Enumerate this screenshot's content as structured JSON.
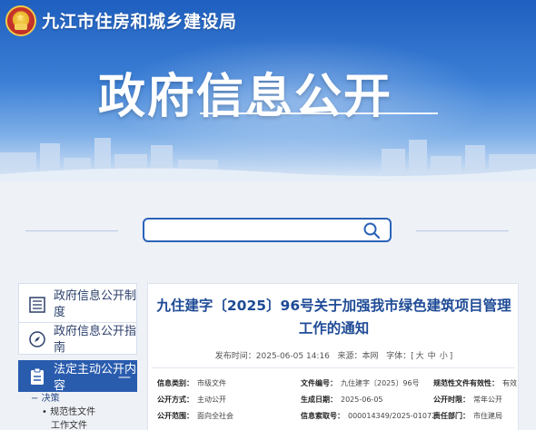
{
  "header": {
    "site_name": "九江市住房和城乡建设局",
    "page_heading": "政府信息公开"
  },
  "search": {
    "placeholder": "",
    "value": ""
  },
  "sidebar": {
    "items": [
      {
        "label": "政府信息公开制度",
        "icon": "document-list-icon"
      },
      {
        "label": "政府信息公开指南",
        "icon": "compass-icon"
      },
      {
        "label": "法定主动公开内容",
        "icon": "clipboard-icon",
        "toggle": "—"
      }
    ],
    "sub_items": [
      {
        "label": "决策",
        "prefix": "−"
      },
      {
        "label": "规范性文件",
        "prefix": "•"
      },
      {
        "label": "工作文件",
        "prefix": ""
      }
    ]
  },
  "article": {
    "title": "九住建字〔2025〕96号关于加强我市绿色建筑项目管理工作的通知",
    "publish_label": "发布时间：",
    "publish_time": "2025-06-05 14:16",
    "source_label": "来源：",
    "source": "本网",
    "font_label": "字体：",
    "font_sizes": [
      "大",
      "中",
      "小"
    ],
    "info": [
      [
        {
          "key": "信息类别：",
          "value": "市级文件"
        },
        {
          "key": "文件编号：",
          "value": "九住建字〔2025〕96号"
        },
        {
          "key": "规范性文件有效性：",
          "value": "有效"
        }
      ],
      [
        {
          "key": "公开方式：",
          "value": "主动公开"
        },
        {
          "key": "生成日期：",
          "value": "2025-06-05"
        },
        {
          "key": "公开时限：",
          "value": "常年公开"
        }
      ],
      [
        {
          "key": "公开范围：",
          "value": "面向全社会"
        },
        {
          "key": "信息索取号：",
          "value": "000014349/2025-01072"
        },
        {
          "key": "责任部门：",
          "value": "市住建局"
        }
      ]
    ]
  },
  "colors": {
    "brand_blue": "#2a5cae",
    "title_blue": "#1f4b96",
    "banner_top": "#1f5fbf"
  }
}
